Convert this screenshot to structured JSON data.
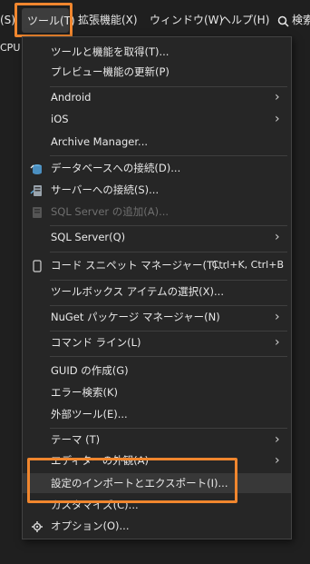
{
  "menubar": {
    "left_fragment": "(S)",
    "tools": "ツール(T)",
    "extensions": "拡張機能(X)",
    "window": "ウィンドウ(W)",
    "help": "ヘルプ(H)",
    "search_label": "検索"
  },
  "background": {
    "cpu_label": "CPU"
  },
  "menu": {
    "items": [
      {
        "label": "ツールと機能を取得(T)..."
      },
      {
        "label": "プレビュー機能の更新(P)"
      },
      {
        "label": "Android",
        "submenu": true
      },
      {
        "label": "iOS",
        "submenu": true
      },
      {
        "label": "Archive Manager..."
      },
      {
        "label": "データベースへの接続(D)...",
        "icon": "database-connect-icon"
      },
      {
        "label": "サーバーへの接続(S)...",
        "icon": "server-connect-icon"
      },
      {
        "label": "SQL Server の追加(A)...",
        "icon": "sql-server-add-icon",
        "disabled": true
      },
      {
        "label": "SQL Server(Q)",
        "submenu": true
      },
      {
        "label": "コード スニペット マネージャー(T)...",
        "icon": "snippet-icon",
        "shortcut": "Ctrl+K, Ctrl+B"
      },
      {
        "label": "ツールボックス アイテムの選択(X)..."
      },
      {
        "label": "NuGet パッケージ マネージャー(N)",
        "submenu": true
      },
      {
        "label": "コマンド ライン(L)",
        "submenu": true
      },
      {
        "label": "GUID の作成(G)"
      },
      {
        "label": "エラー検索(K)"
      },
      {
        "label": "外部ツール(E)..."
      },
      {
        "label": "テーマ (T)",
        "submenu": true
      },
      {
        "label": "エディターの外観(A)",
        "submenu": true
      },
      {
        "label": "設定のインポートとエクスポート(I)...",
        "hovered": true
      },
      {
        "label": "カスタマイズ(C)..."
      },
      {
        "label": "オプション(O)...",
        "icon": "gear-icon"
      }
    ]
  },
  "colors": {
    "highlight_box": "#f0862e",
    "menu_bg": "#262626",
    "hover_bg": "#383838",
    "disabled_text": "#6f6f6f"
  }
}
